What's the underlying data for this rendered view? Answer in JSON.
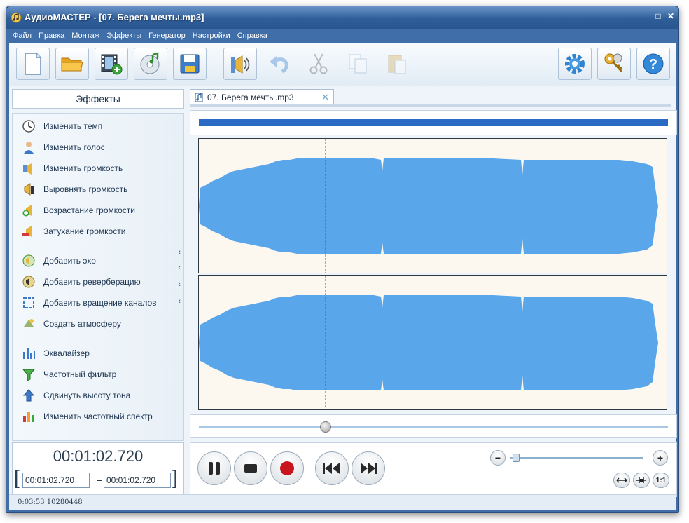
{
  "window": {
    "title": "АудиоМАСТЕР - [07. Берега мечты.mp3]"
  },
  "menu": [
    "Файл",
    "Правка",
    "Монтаж",
    "Эффекты",
    "Генератор",
    "Настройки",
    "Справка"
  ],
  "toolbar": {
    "icons": [
      "new-file-icon",
      "open-folder-icon",
      "add-video-icon",
      "cd-icon",
      "save-icon",
      "volume-edit-icon",
      "undo-icon",
      "cut-icon",
      "copy-icon",
      "paste-icon",
      "settings-icon",
      "keys-icon",
      "help-icon"
    ]
  },
  "effects_panel": {
    "title": "Эффекты",
    "items": [
      {
        "label": "Изменить темп",
        "icon": "clock-icon"
      },
      {
        "label": "Изменить голос",
        "icon": "voice-icon"
      },
      {
        "label": "Изменить громкость",
        "icon": "volume-icon"
      },
      {
        "label": "Выровнять громкость",
        "icon": "normalize-icon"
      },
      {
        "label": "Возрастание громкости",
        "icon": "fade-in-icon"
      },
      {
        "label": "Затухание громкости",
        "icon": "fade-out-icon"
      },
      {
        "label": "Добавить эхо",
        "icon": "echo-icon"
      },
      {
        "label": "Добавить реверберацию",
        "icon": "reverb-icon"
      },
      {
        "label": "Добавить вращение каналов",
        "icon": "rotate-icon"
      },
      {
        "label": "Создать атмосферу",
        "icon": "atmosphere-icon"
      },
      {
        "label": "Эквалайзер",
        "icon": "equalizer-icon"
      },
      {
        "label": "Частотный фильтр",
        "icon": "filter-icon"
      },
      {
        "label": "Сдвинуть высоту тона",
        "icon": "pitch-icon"
      },
      {
        "label": "Изменить частотный спектр",
        "icon": "spectrum-icon"
      }
    ]
  },
  "time": {
    "current": "00:01:02.720",
    "selection_start": "00:01:02.720",
    "selection_end": "00:01:02.720",
    "dash": "–",
    "open_bracket": "[",
    "close_bracket": "]"
  },
  "status": {
    "text": "0:03:53 10280448"
  },
  "tab": {
    "label": "07. Берега мечты.mp3",
    "close": "✕"
  },
  "player": {
    "position_fraction": 0.27,
    "zoom_minus": "−",
    "zoom_plus": "+",
    "fit_label": "1:1"
  },
  "colors": {
    "waveform": "#5aa6ea",
    "background": "#fcf8ef",
    "cursor": "#b03a3a",
    "overview": "#2a6ac4"
  }
}
